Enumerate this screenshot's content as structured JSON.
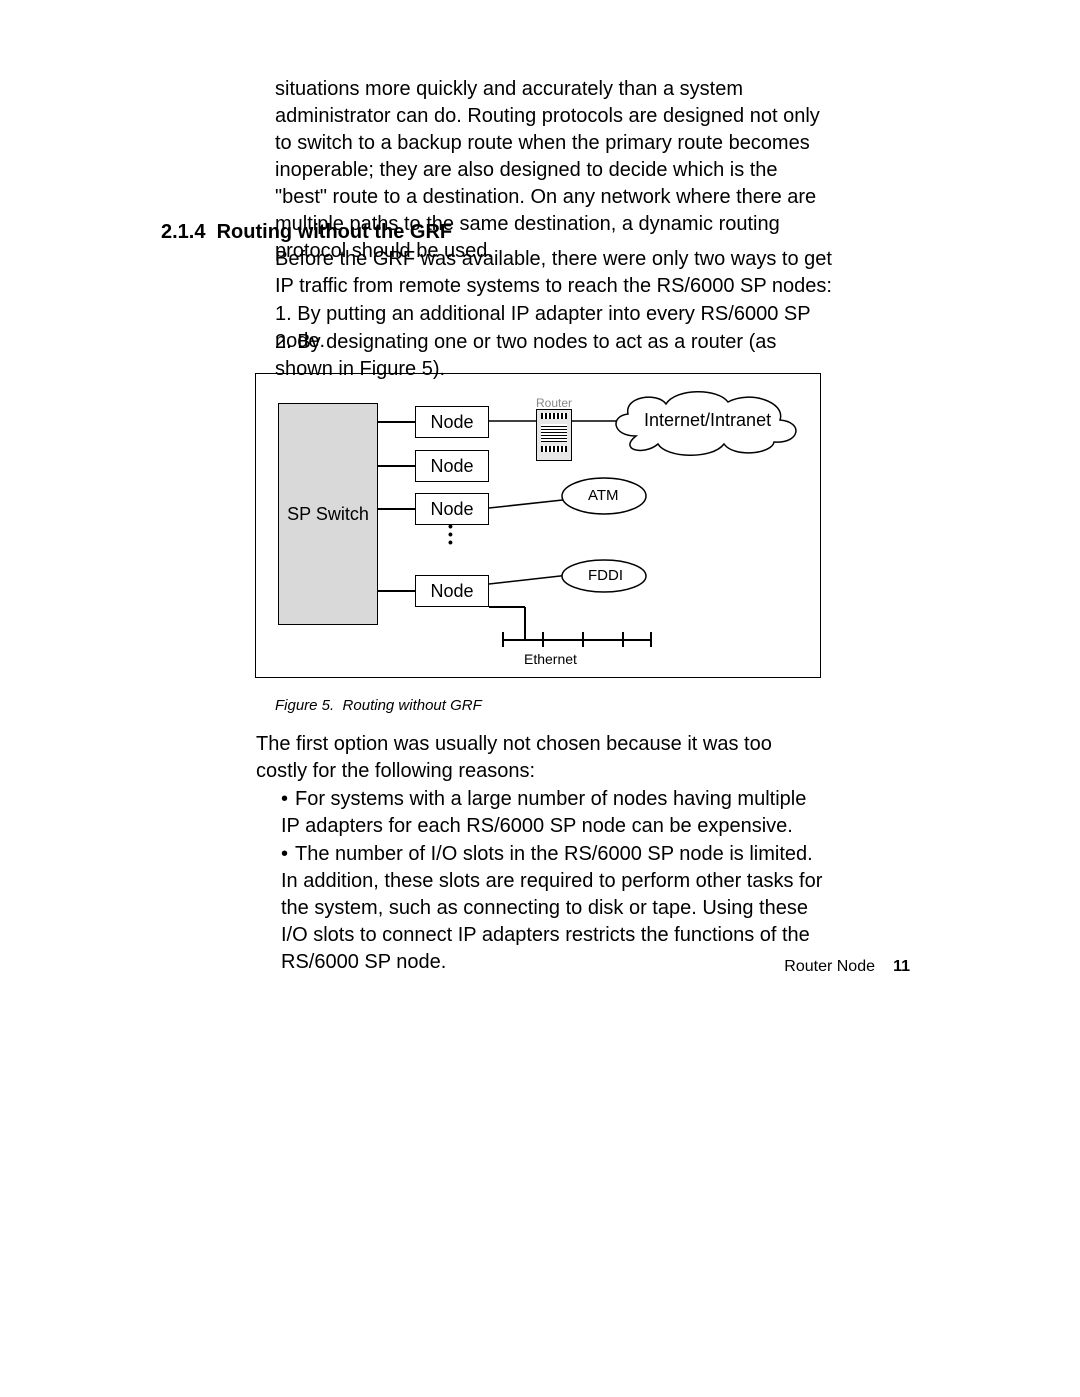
{
  "intro_paragraph": "situations more quickly and accurately than a system administrator can do. Routing protocols are designed not only to switch to a backup route when the primary route becomes inoperable; they are also designed to decide which is the \"best\" route to a destination. On any network where there are multiple paths to the same destination, a dynamic routing protocol should be used.",
  "section": {
    "number": "2.1.4",
    "title": "Routing without the GRF"
  },
  "before_text": "Before the GRF was available, there were only two ways to get IP traffic from remote systems to reach the RS/6000 SP nodes:",
  "ordered_list": {
    "item1_num": "1.",
    "item1": "By putting an additional IP adapter into every RS/6000 SP node.",
    "item2_num": "2.",
    "item2": "By designating one or two nodes to act as a router (as shown in Figure 5)."
  },
  "figure": {
    "caption_prefix": "Figure 5.",
    "caption": "Routing without GRF",
    "sp_switch": "SP Switch",
    "node": "Node",
    "router": "Router",
    "internet": "Internet/Intranet",
    "atm": "ATM",
    "fddi": "FDDI",
    "ethernet": "Ethernet"
  },
  "after_text": "The first option was usually not chosen because it was too costly for the following reasons:",
  "bullets": {
    "b1": "For systems with a large number of nodes having multiple IP adapters for each RS/6000 SP node can be expensive.",
    "b2": "The number of I/O slots in the RS/6000 SP node is limited. In addition, these slots are required to perform other tasks for the system, such as connecting to disk or tape. Using these I/O slots to connect IP adapters restricts the functions of the RS/6000 SP node."
  },
  "footer": {
    "section": "Router Node",
    "page": "11"
  }
}
